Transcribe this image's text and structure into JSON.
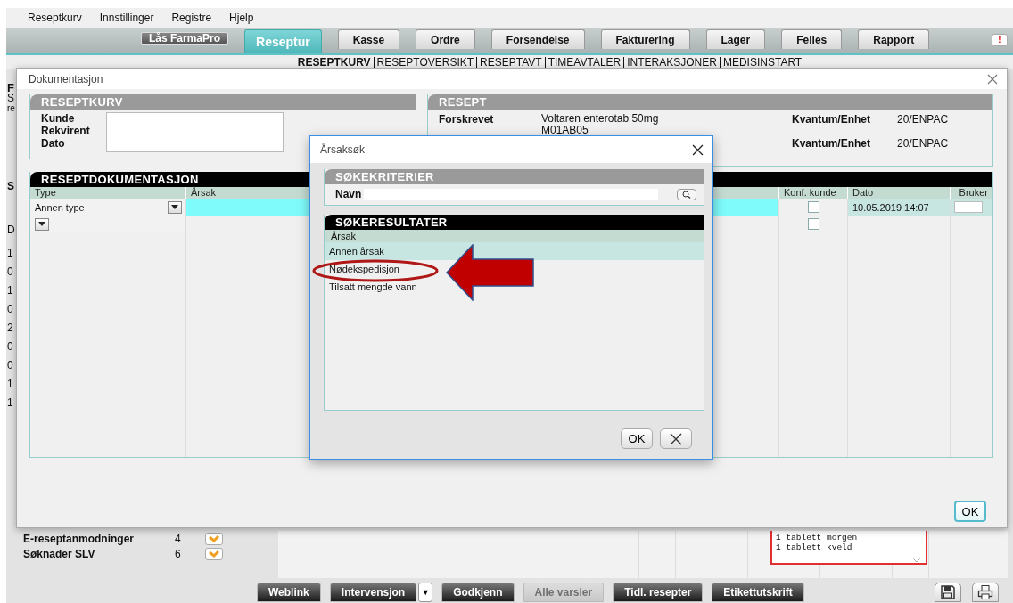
{
  "menu": [
    "Reseptkurv",
    "Innstillinger",
    "Registre",
    "Hjelp"
  ],
  "lock_button": "Lås FarmaPro",
  "tabs": [
    {
      "label": "Reseptur",
      "selected": true
    },
    {
      "label": "Kasse",
      "selected": false
    },
    {
      "label": "Ordre",
      "selected": false
    },
    {
      "label": "Forsendelse",
      "selected": false
    },
    {
      "label": "Fakturering",
      "selected": false
    },
    {
      "label": "Lager",
      "selected": false
    },
    {
      "label": "Felles",
      "selected": false
    },
    {
      "label": "Rapport",
      "selected": false
    }
  ],
  "alert_badge": "!",
  "subnav": [
    {
      "label": "RESEPTKURV",
      "selected": true
    },
    {
      "label": "RESEPTOVERSIKT",
      "selected": false
    },
    {
      "label": "RESEPTAVT",
      "selected": false
    },
    {
      "label": "TIMEAVTALER",
      "selected": false
    },
    {
      "label": "INTERAKSJONER",
      "selected": false
    },
    {
      "label": "MEDISINSTART",
      "selected": false
    }
  ],
  "background_fragments": [
    "F",
    "S",
    "re",
    "S",
    "D",
    "1",
    "0",
    "1",
    "0",
    "2",
    "0",
    "0",
    "1",
    "1"
  ],
  "queues": [
    {
      "label": "E-reseptanmodninger",
      "count": "4"
    },
    {
      "label": "Søknader SLV",
      "count": "6"
    }
  ],
  "dosage_text": [
    "1 tablett morgen",
    "1 tablett kveld"
  ],
  "bottom_buttons": [
    {
      "label": "Weblink",
      "disabled": false,
      "dropdown": false
    },
    {
      "label": "Intervensjon",
      "disabled": false,
      "dropdown": true
    },
    {
      "label": "Godkjenn",
      "disabled": false,
      "dropdown": false
    },
    {
      "label": "Alle varsler",
      "disabled": true,
      "dropdown": false
    },
    {
      "label": "Tidl. resepter",
      "disabled": false,
      "dropdown": false
    },
    {
      "label": "Etikettutskrift",
      "disabled": false,
      "dropdown": false
    }
  ],
  "dropdown_glyph": "▼",
  "documentation_dialog": {
    "title": "Dokumentasjon",
    "reseptkurv": {
      "title": "RESEPTKURV",
      "labels": [
        "Kunde",
        "Rekvirent",
        "Dato"
      ]
    },
    "resept": {
      "title": "RESEPT",
      "fields": [
        {
          "label": "Forskrevet",
          "value": "Voltaren enterotab 50mg",
          "sub": "M01AB05",
          "qty_label": "Kvantum/Enhet",
          "qty": "20/ENPAC"
        },
        {
          "qty_label": "Kvantum/Enhet",
          "qty": "20/ENPAC"
        }
      ]
    },
    "documentation": {
      "title": "RESEPTDOKUMENTASJON",
      "columns": [
        "Type",
        "Årsak",
        "Konf. kunde",
        "Dato",
        "Bruker"
      ],
      "rows": [
        {
          "type": "Annen type",
          "selected": true,
          "checked": false,
          "date": "10.05.2019 14:07"
        },
        {
          "selected": false,
          "checked": false
        }
      ]
    },
    "ok": "OK"
  },
  "search_dialog": {
    "title": "Årsaksøk",
    "criteria": {
      "title": "SØKEKRITERIER",
      "label": "Navn"
    },
    "results": {
      "title": "SØKERESULTATER",
      "column": "Årsak",
      "items": [
        {
          "label": "Annen årsak",
          "selected": true
        },
        {
          "label": "Nødekspedisjon",
          "selected": false
        },
        {
          "label": "Tilsatt mengde vann",
          "selected": false
        }
      ]
    },
    "ok": "OK"
  },
  "annotations": [
    {
      "kind": "ellipse"
    },
    {
      "kind": "arrow"
    }
  ]
}
